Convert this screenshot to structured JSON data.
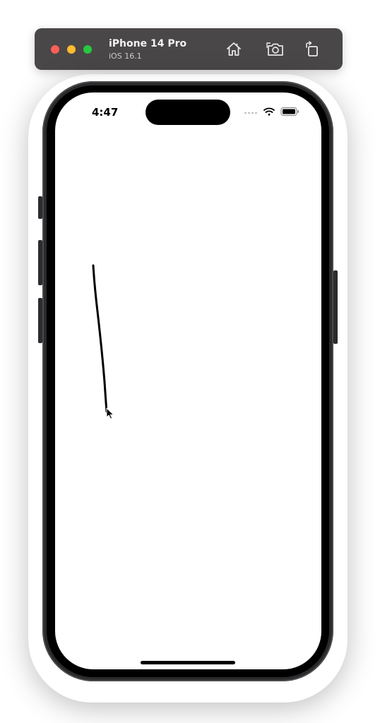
{
  "simulator": {
    "device_name": "iPhone 14 Pro",
    "os_version": "iOS 16.1",
    "toolbar_buttons": [
      {
        "name": "home",
        "icon": "home-icon"
      },
      {
        "name": "screenshot",
        "icon": "screenshot-icon"
      },
      {
        "name": "rotate",
        "icon": "rotate-icon"
      }
    ],
    "window_controls": {
      "close_color": "#ff5f57",
      "minimize_color": "#febc2e",
      "zoom_color": "#28c840"
    }
  },
  "status_bar": {
    "time": "4:47",
    "icons": [
      "signal-icon",
      "wifi-icon",
      "battery-icon"
    ]
  },
  "canvas": {
    "background": "#ffffff",
    "stroke_color": "#000000",
    "content": "single hand-drawn stroke",
    "cursor_icon": "arrow-cursor-icon"
  }
}
